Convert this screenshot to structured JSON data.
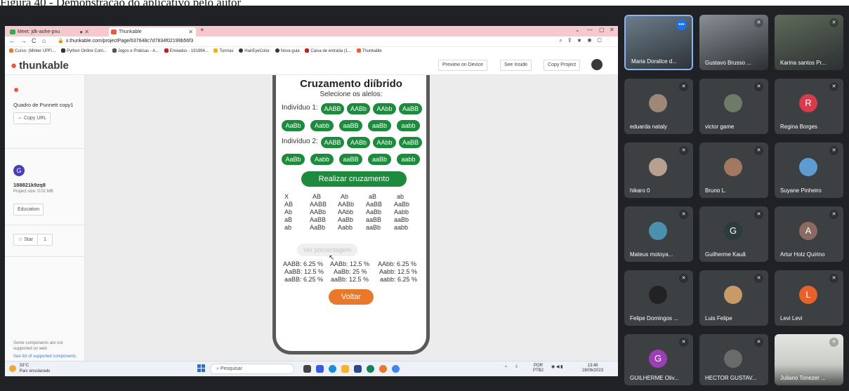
{
  "caption": "Figura 40 - Demonstração do aplicativo pelo autor",
  "browser": {
    "tabs": [
      {
        "label": "Meet: jdk-aohe-pnu",
        "favicon_color": "#34a853"
      },
      {
        "label": "Thunkable",
        "favicon_color": "#e75a3a"
      }
    ],
    "url": "x.thunkable.com/projectPage/637648c7d7834f02199b56f3",
    "bookmarks": [
      {
        "label": "Curso: (Minter UPF/...",
        "color": "#e8792a"
      },
      {
        "label": "Python Online Com...",
        "color": "#333333"
      },
      {
        "label": "Jogos e Práticas - A...",
        "color": "#555555"
      },
      {
        "label": "Enviados - 191994...",
        "color": "#c5221f"
      },
      {
        "label": "Turmas",
        "color": "#f4b400"
      },
      {
        "label": "HairEyeColor",
        "color": "#333333"
      },
      {
        "label": "Nova guia",
        "color": "#333333"
      },
      {
        "label": "Caixa de entrada (1...",
        "color": "#c5221f"
      },
      {
        "label": "Thunkable",
        "color": "#e75a3a"
      }
    ]
  },
  "thunkable": {
    "logo": "thunkable",
    "header_buttons": [
      "Preview on Device",
      "See Inside",
      "Copy Project"
    ],
    "sidebar": {
      "project_title": "Quadro de Punnett copy1",
      "copy_url": "Copy URL",
      "user_initial": "G",
      "project_id": "188821k9zq8",
      "project_size": "Project size: 0.02 MB",
      "category": "Education",
      "star_label": "Star",
      "star_count": "1",
      "note": "Some components are not supported on web",
      "link": "See list of supported components"
    }
  },
  "app": {
    "title": "Cruzamento diíbrido",
    "subtitle": "Selecione os alelos:",
    "individuo1_label": "Indivíduo 1:",
    "individuo2_label": "Indivíduo 2:",
    "row_a": [
      "AABB",
      "AABb",
      "AAbb",
      "AaBB"
    ],
    "row_b": [
      "AaBb",
      "Aabb",
      "aaBB",
      "aaBb",
      "aabb"
    ],
    "cross_button": "Realizar cruzamento",
    "punnett": [
      [
        "X",
        "AB",
        "Ab",
        "aB",
        "ab"
      ],
      [
        "AB",
        "AABB",
        "AABb",
        "AaBB",
        "AaBb"
      ],
      [
        "Ab",
        "AABb",
        "AAbb",
        "AaBb",
        "Aabb"
      ],
      [
        "aB",
        "AaBB",
        "AaBb",
        "aaBB",
        "aaBb"
      ],
      [
        "ab",
        "AaBb",
        "Aabb",
        "aaBb",
        "aabb"
      ]
    ],
    "percent_button": "Ver porcentagem",
    "percentages": [
      [
        "AABB: 6.25 %",
        "AABb: 12.5 %",
        "AAbb: 6.25 %"
      ],
      [
        "AaBB: 12.5 %",
        "AaBb: 25 %",
        "Aabb: 12.5 %"
      ],
      [
        "aaBB: 6.25 %",
        "aaBb: 12.5 %",
        "aabb: 6.25 %"
      ]
    ],
    "back_button": "Voltar"
  },
  "taskbar": {
    "temp": "33°C",
    "weather": "Parc ensolarado",
    "search": "Pesquisar",
    "lang": "POR",
    "layout": "PTB2",
    "time": "13:46",
    "date": "28/06/2023"
  },
  "participants": [
    {
      "name": "Maria Doralice d...",
      "type": "photo",
      "color": "#6b7d8a",
      "speaking": true
    },
    {
      "name": "Gustavo Brusso ...",
      "type": "photo",
      "color": "#8a8f96"
    },
    {
      "name": "Karina santos Pr...",
      "type": "photo",
      "color": "#5f6b59"
    },
    {
      "name": "eduarda nataly",
      "type": "photo",
      "color": "#a08878"
    },
    {
      "name": "victor game",
      "type": "photo",
      "color": "#6e7b68"
    },
    {
      "name": "Regina Borges",
      "type": "initial",
      "initial": "R",
      "color": "#d93a4e"
    },
    {
      "name": "hikaro 0",
      "type": "photo",
      "color": "#b8a090"
    },
    {
      "name": "Bruno L.",
      "type": "photo",
      "color": "#a27863"
    },
    {
      "name": "Suyane Pinheiro",
      "type": "photo",
      "color": "#5d9bd1"
    },
    {
      "name": "Mateus motoya...",
      "type": "photo",
      "color": "#4c90b0"
    },
    {
      "name": "Guilherme Kauã",
      "type": "initial",
      "initial": "G",
      "color": "#2d3b3a"
    },
    {
      "name": "Artur Holz Quirino",
      "type": "initial",
      "initial": "A",
      "color": "#8b6a62"
    },
    {
      "name": "Felipe Domingos ...",
      "type": "photo",
      "color": "#222222"
    },
    {
      "name": "Luis Felipe",
      "type": "photo",
      "color": "#c79a68"
    },
    {
      "name": "Levi Levi",
      "type": "initial",
      "initial": "L",
      "color": "#e6622a"
    },
    {
      "name": "GUILHERME Oliv...",
      "type": "initial",
      "initial": "G",
      "color": "#9b3fb5"
    },
    {
      "name": "HECTOR GUSTAV...",
      "type": "photo",
      "color": "#6a6a6a"
    },
    {
      "name": "Juliano Tonezer ...",
      "type": "video",
      "color": "#d9dcd6"
    }
  ]
}
